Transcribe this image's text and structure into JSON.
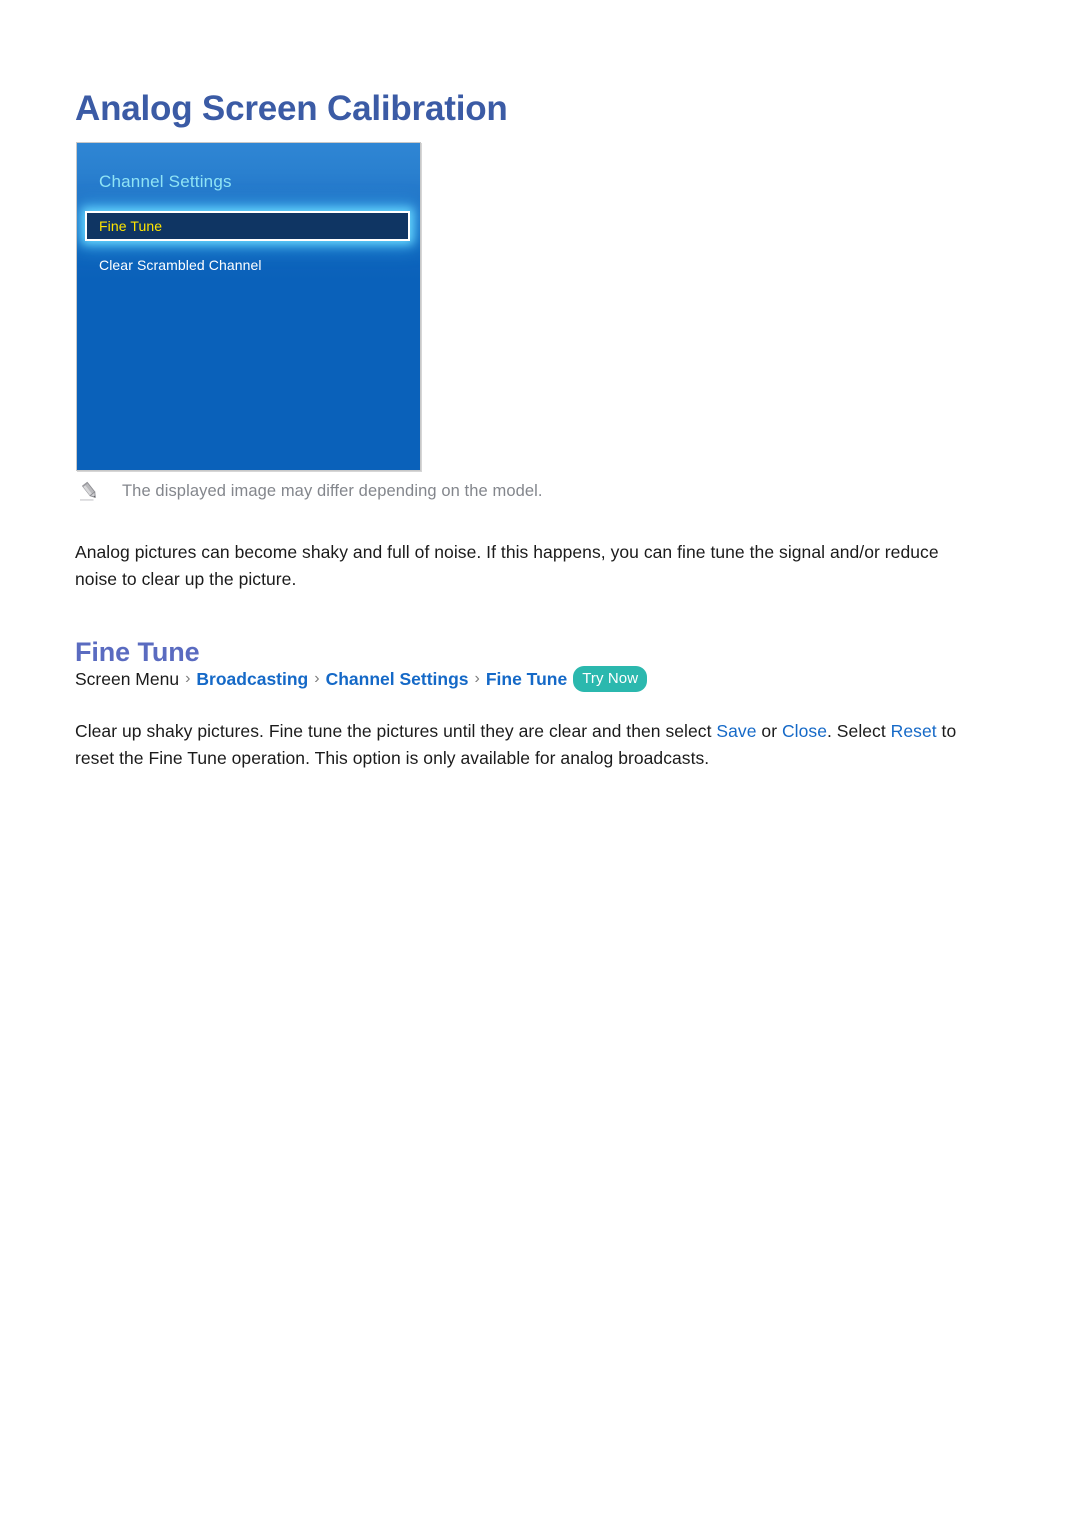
{
  "page": {
    "title": "Analog Screen Calibration",
    "background_color": "#ffffff",
    "title_color": "#3b5ba5"
  },
  "tv_panel": {
    "menu_title": "Channel Settings",
    "accent_title_color": "#8fe3f5",
    "panel_color": "#0a61ba",
    "selected_row_fill": "#0f3563",
    "selected_row_text_color": "#ffe500",
    "items": [
      {
        "label": "Fine Tune",
        "selected": true
      },
      {
        "label": "Clear Scrambled Channel",
        "selected": false
      }
    ]
  },
  "note": {
    "icon": "pencil-icon",
    "text": "The displayed image may differ depending on the model.",
    "text_color": "#83868c"
  },
  "intro_paragraph": "Analog pictures can become shaky and full of noise. If this happens, you can fine tune the signal and/or reduce noise to clear up the picture.",
  "section": {
    "heading": "Fine Tune",
    "heading_color": "#5a6bc0"
  },
  "breadcrumb": {
    "root": "Screen Menu",
    "separator": "›",
    "links": [
      "Broadcasting",
      "Channel Settings",
      "Fine Tune"
    ],
    "link_color": "#1569c7",
    "badge": {
      "label": "Try Now",
      "background_color": "#2bb8ae",
      "text_color": "#ffffff"
    }
  },
  "detail_paragraph": {
    "part1": "Clear up shaky pictures. Fine tune the pictures until they are clear and then select ",
    "kw_save": "Save",
    "part2": " or ",
    "kw_close": "Close",
    "part3": ". Select ",
    "kw_reset": "Reset",
    "part4": " to reset the Fine Tune operation. This option is only available for analog broadcasts."
  }
}
